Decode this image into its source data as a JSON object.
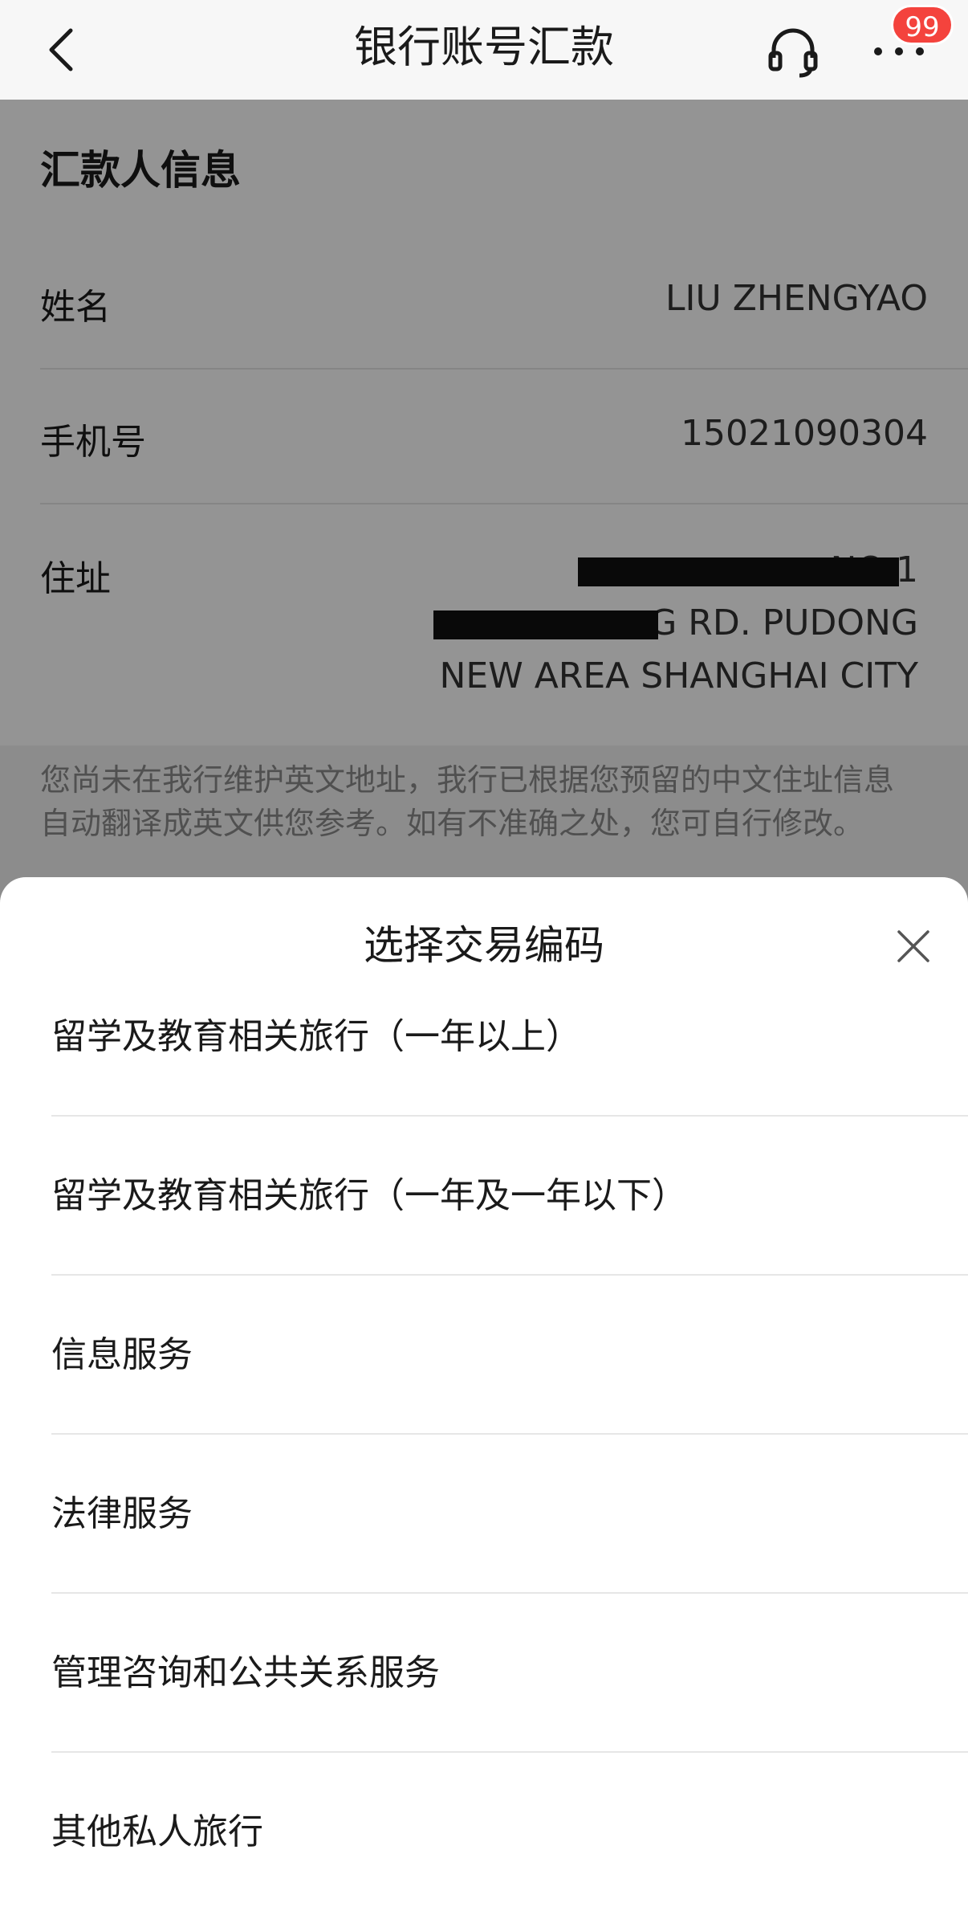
{
  "header": {
    "title": "银行账号汇款",
    "badge": "99",
    "icons": {
      "back": "chevron-left-icon",
      "service": "headset-icon",
      "more": "more-dots-icon"
    }
  },
  "remitter": {
    "section_title": "汇款人信息",
    "name_label": "姓名",
    "name_value": "LIU ZHENGYAO",
    "phone_label": "手机号",
    "phone_value": "15021090304",
    "address_label": "住址",
    "address_lines": [
      "NO 1",
      "G RD. PUDONG",
      "NEW AREA SHANGHAI CITY"
    ]
  },
  "notice": "您尚未在我行维护英文地址，我行已根据您预留的中文住址信息自动翻译成英文供您参考。如有不准确之处，您可自行修改。",
  "sheet": {
    "title": "选择交易编码",
    "options": [
      "留学及教育相关旅行（一年以上）",
      "留学及教育相关旅行（一年及一年以下）",
      "信息服务",
      "法律服务",
      "管理咨询和公共关系服务",
      "其他私人旅行"
    ]
  },
  "colors": {
    "badge": "#f4433d",
    "overlay": "rgba(0,0,0,0.42)",
    "text": "#1a1a1a",
    "muted": "#8a8a8a"
  }
}
